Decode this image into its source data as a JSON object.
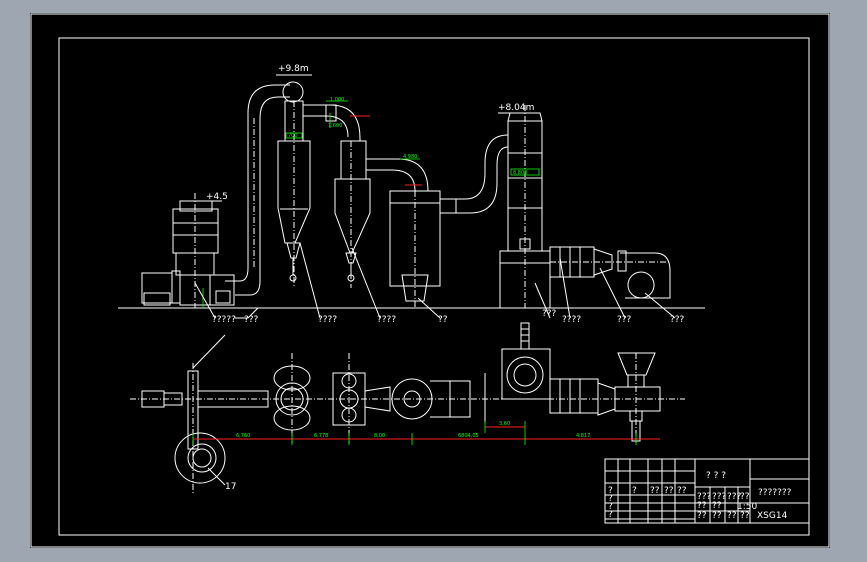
{
  "elevation_marks": {
    "cyclone": "+9.8m",
    "tower": "+8.04m",
    "feeder": "+4.5"
  },
  "component_callouts": [
    "?????",
    "???",
    "????",
    "????",
    "??",
    "???",
    "????",
    "???",
    "???",
    "??"
  ],
  "plan_label": "17",
  "dimensions": {
    "d1": "6,760",
    "d2": "6,778",
    "d3": "8,00",
    "d4": "6804,05",
    "d5": "3,60",
    "d6": "4,817"
  },
  "upper_dims": [
    "1,000",
    "1,600",
    "4,980",
    "700",
    "8,800"
  ],
  "title_block": {
    "drawing_title": "? ? ?",
    "drawing_name": "???????",
    "drawing_code": "XSG14",
    "scale": "1:50",
    "cells": [
      "?",
      "?",
      "?",
      "?",
      "?",
      "??",
      "??",
      "??",
      "???",
      "???",
      "???",
      "??",
      "??",
      "??",
      "??",
      "??",
      "??",
      "??"
    ]
  },
  "colors": {
    "background": "#9ea6b2",
    "sheet": "#000000",
    "lines": "#ffffff",
    "dimensions": "#00ff00",
    "centerlines": "#ff2020"
  }
}
